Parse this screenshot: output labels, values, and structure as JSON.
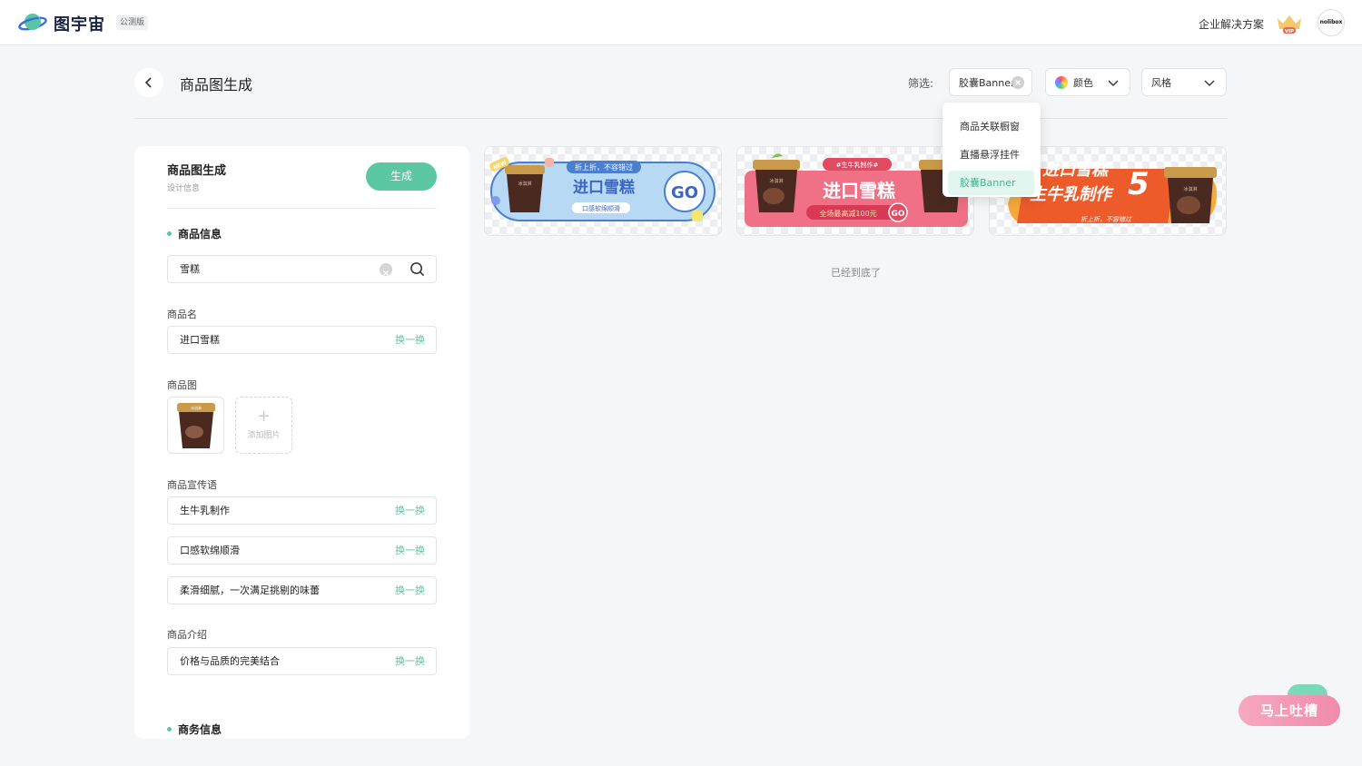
{
  "header": {
    "logo_text": "图宇宙",
    "beta_badge": "公测版",
    "enterprise_link": "企业解决方案",
    "vip_label": "VIP",
    "avatar_text": "nolibox"
  },
  "toolbar": {
    "page_title": "商品图生成",
    "filter_label": "筛选:",
    "type_filter_value": "胶囊Banner",
    "color_filter_label": "颜色",
    "style_filter_label": "风格"
  },
  "dropdown": {
    "items": [
      "商品关联橱窗",
      "直播悬浮挂件",
      "胶囊Banner"
    ],
    "selected": "胶囊Banner"
  },
  "panel": {
    "title": "商品图生成",
    "subtitle": "设计信息",
    "generate_label": "生成",
    "section_product": "商品信息",
    "search_value": "雪糕",
    "name_label": "商品名",
    "name_value": "进口雪糕",
    "swap_label": "换一换",
    "image_label": "商品图",
    "add_image_label": "添加图片",
    "slogan_label": "商品宣传语",
    "slogans": [
      "生牛乳制作",
      "口感软绵顺滑",
      "柔滑细腻，一次满足挑剔的味蕾"
    ],
    "intro_label": "商品介绍",
    "intro_value": "价格与品质的完美结合",
    "section_business": "商务信息"
  },
  "cards": [
    {
      "tag": "折上折，不容错过",
      "title": "进口雪糕",
      "subtitle": "口感软绵顺滑",
      "go": "GO",
      "badge": "NEW",
      "cup_label": "冰淇淋",
      "bg": "#b8d9f3",
      "accent": "#4a7fd0"
    },
    {
      "tag": "#生牛乳制作#",
      "title": "进口雪糕",
      "subtitle": "全场最高减100元",
      "go": "GO",
      "cup_label": "冰淇淋",
      "bg": "#f07085",
      "accent": "#e24a62"
    },
    {
      "title_line1": "进口雪糕",
      "title_line2": "生牛乳制作",
      "number": "5",
      "subtitle": "折上折，不容错过",
      "cup_label": "冰淇淋",
      "bg": "#f6a93b",
      "accent": "#ee5b2a"
    }
  ],
  "list_end_text": "已经到底了",
  "feedback_label": "马上吐槽",
  "colors": {
    "primary": "#5cc7a3",
    "background": "#f5f6f8"
  }
}
